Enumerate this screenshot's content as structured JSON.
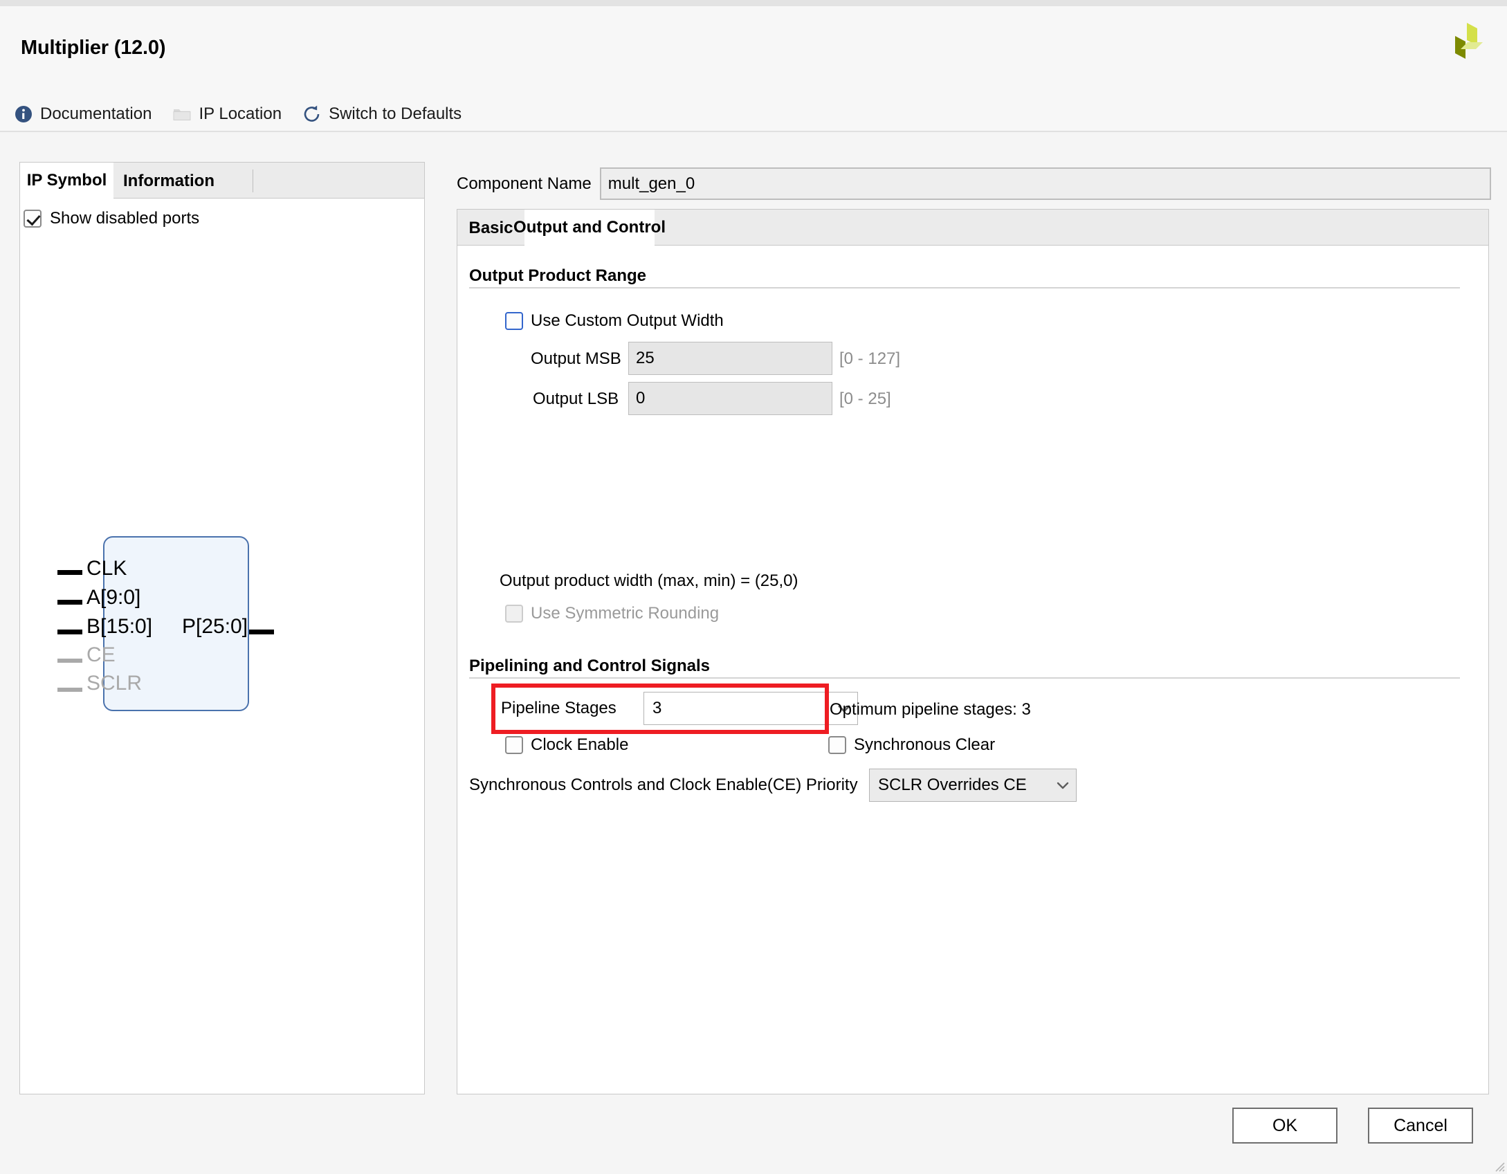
{
  "window": {
    "title": "Multiplier (12.0)",
    "logo_colors": {
      "dark": "#7d8a00",
      "mid": "#d4e04a",
      "light": "#e2eb92"
    }
  },
  "toolbar": {
    "items": [
      {
        "label": "Documentation",
        "icon": "info-icon",
        "enabled": true
      },
      {
        "label": "IP Location",
        "icon": "folder-icon",
        "enabled": false
      },
      {
        "label": "Switch to Defaults",
        "icon": "refresh-icon",
        "enabled": true
      }
    ]
  },
  "left_panel": {
    "tabs": [
      {
        "label": "IP Symbol",
        "active": true
      },
      {
        "label": "Information",
        "active": false
      }
    ],
    "show_disabled_ports": {
      "label": "Show disabled ports",
      "checked": true
    },
    "symbol": {
      "inputs": [
        {
          "name": "CLK",
          "enabled": true
        },
        {
          "name": "A[9:0]",
          "enabled": true
        },
        {
          "name": "B[15:0]",
          "enabled": true
        },
        {
          "name": "CE",
          "enabled": false
        },
        {
          "name": "SCLR",
          "enabled": false
        }
      ],
      "outputs": [
        {
          "name": "P[25:0]",
          "enabled": true
        }
      ]
    }
  },
  "component_name": {
    "label": "Component Name",
    "value": "mult_gen_0"
  },
  "right_panel": {
    "tabs": [
      {
        "label": "Basic",
        "active": false
      },
      {
        "label": "Output and Control",
        "active": true
      }
    ],
    "output_product_range": {
      "title": "Output Product Range",
      "use_custom_output_width": {
        "label": "Use Custom Output Width",
        "checked": false
      },
      "output_msb": {
        "label": "Output MSB",
        "value": "25",
        "range": "[0 - 127]"
      },
      "output_lsb": {
        "label": "Output LSB",
        "value": "0",
        "range": "[0 - 25]"
      },
      "width_summary": "Output product width (max, min) = (25,0)",
      "use_symmetric_rounding": {
        "label": "Use Symmetric Rounding",
        "checked": false,
        "enabled": false
      }
    },
    "pipelining": {
      "title": "Pipelining and Control Signals",
      "pipeline_stages": {
        "label": "Pipeline Stages",
        "value": "3",
        "highlighted": true,
        "highlight_color": "#ee1d23"
      },
      "optimum_note": "Optimum pipeline stages: 3",
      "clock_enable": {
        "label": "Clock Enable",
        "checked": false
      },
      "synchronous_clear": {
        "label": "Synchronous Clear",
        "checked": false
      },
      "priority": {
        "label": "Synchronous Controls and Clock Enable(CE) Priority",
        "value": "SCLR Overrides CE"
      }
    }
  },
  "footer": {
    "ok_label": "OK",
    "cancel_label": "Cancel"
  }
}
